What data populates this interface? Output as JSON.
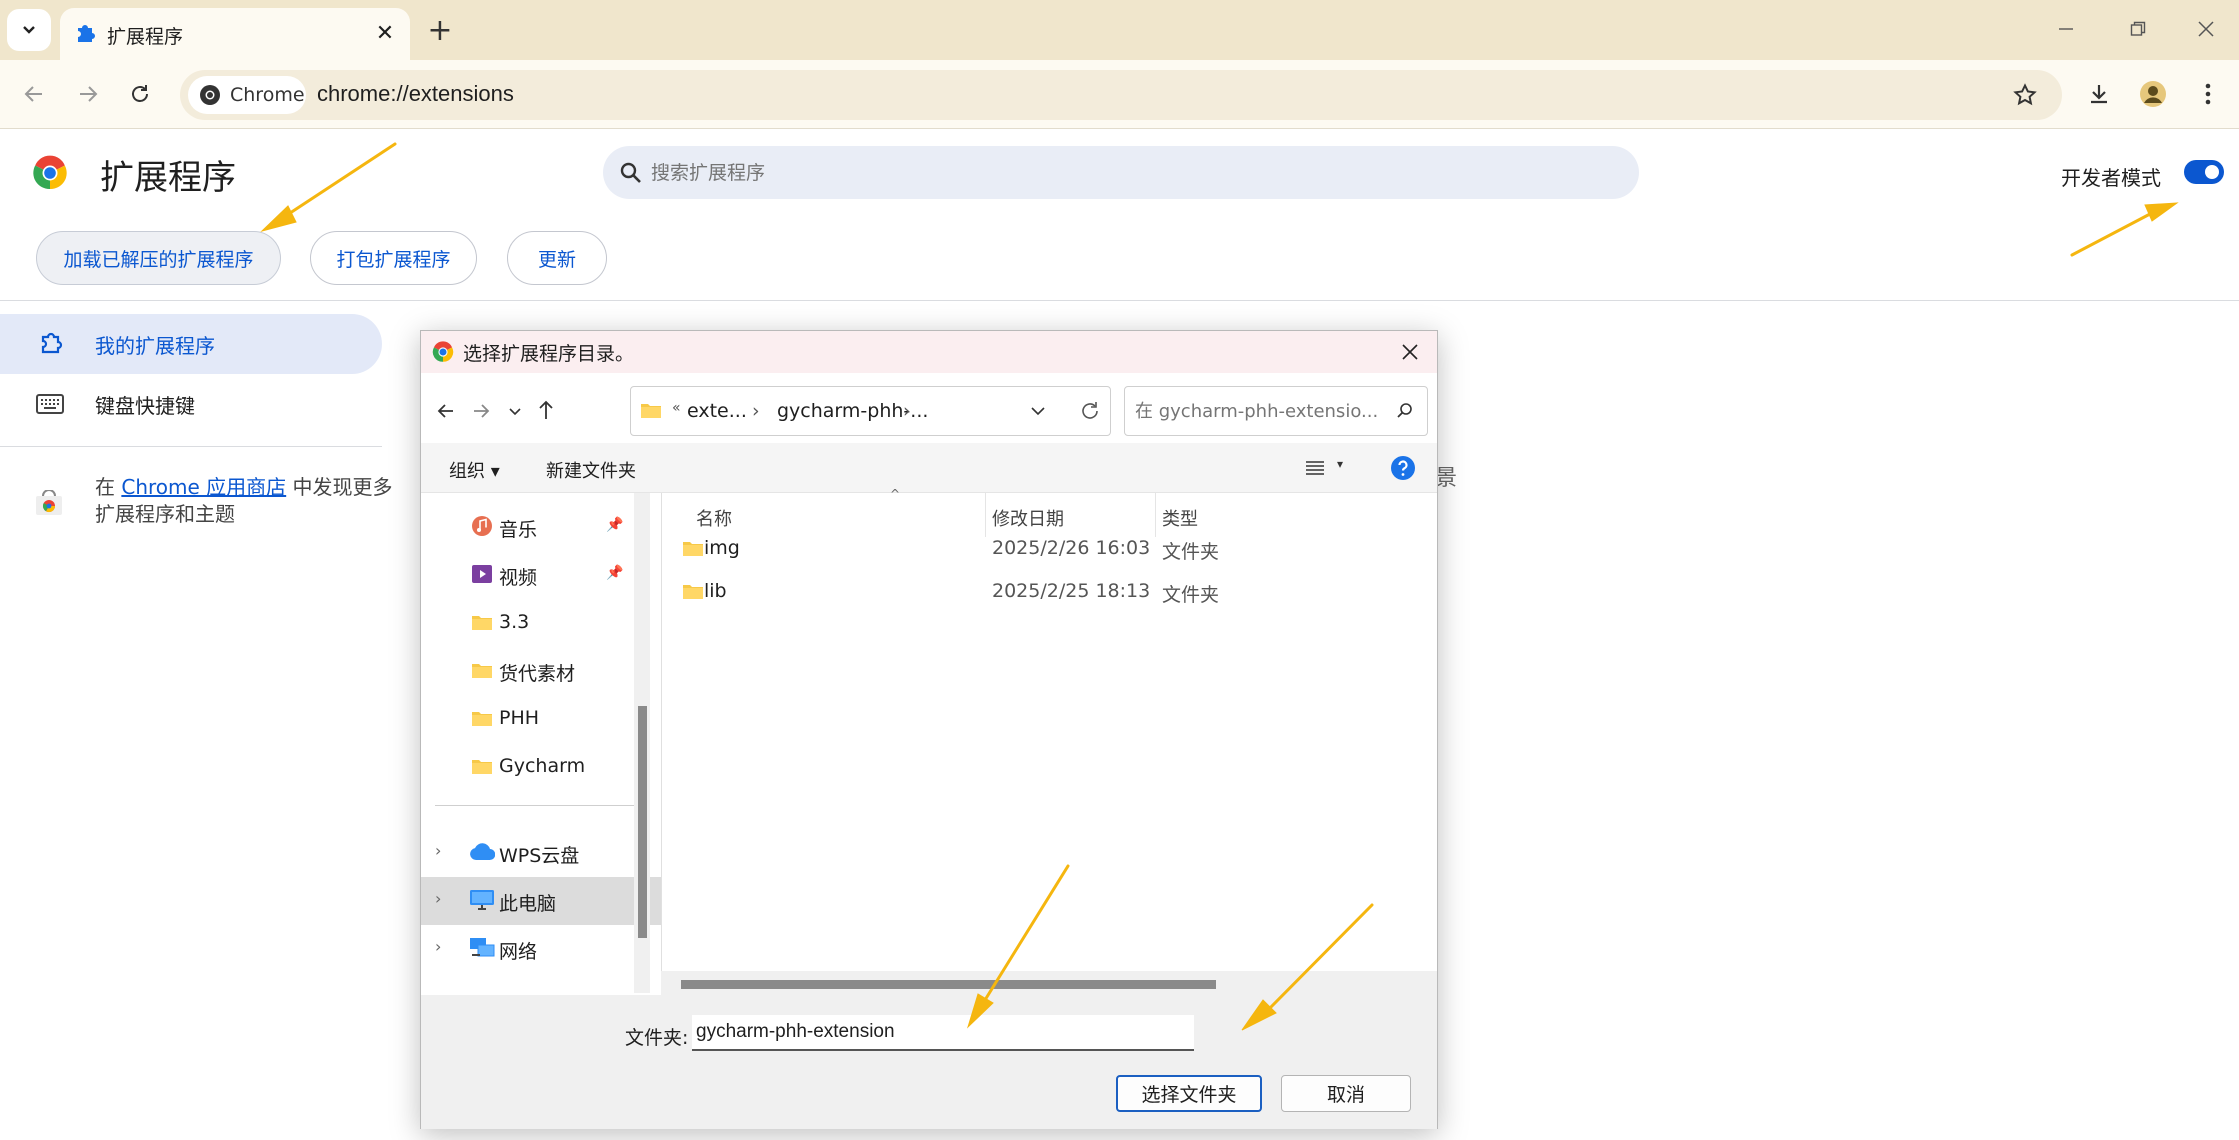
{
  "tab": {
    "title": "扩展程序"
  },
  "omnibox": {
    "chip_label": "Chrome",
    "url": "chrome://extensions"
  },
  "page": {
    "title": "扩展程序",
    "search_placeholder": "搜索扩展程序",
    "dev_mode_label": "开发者模式",
    "dev_mode_on": true,
    "buttons": {
      "load_unpacked": "加载已解压的扩展程序",
      "pack": "打包扩展程序",
      "update": "更新"
    },
    "bg_truncated_text": "景"
  },
  "sidebar": {
    "items": [
      {
        "label": "我的扩展程序"
      },
      {
        "label": "键盘快捷键"
      }
    ],
    "store_prefix": "在 ",
    "store_link": "Chrome 应用商店",
    "store_suffix": " 中发现更多扩展程序和主题"
  },
  "dialog": {
    "title": "选择扩展程序目录。",
    "breadcrumbs": [
      "«",
      "exte...",
      "›",
      "gycharm-phh-...",
      "›"
    ],
    "search_placeholder": "在 gycharm-phh-extensio...",
    "organize_label": "组织 ▾",
    "new_folder_label": "新建文件夹",
    "nav_items": [
      {
        "label": "音乐",
        "icon": "music-icon",
        "pinned": true
      },
      {
        "label": "视频",
        "icon": "video-icon",
        "pinned": true
      },
      {
        "label": "3.3",
        "icon": "folder-icon",
        "pinned": false
      },
      {
        "label": "货代素材",
        "icon": "folder-icon",
        "pinned": false
      },
      {
        "label": "PHH",
        "icon": "folder-icon",
        "pinned": false
      },
      {
        "label": "Gycharm",
        "icon": "folder-icon",
        "pinned": false
      }
    ],
    "nav_roots": [
      {
        "label": "WPS云盘",
        "icon": "cloud-icon"
      },
      {
        "label": "此电脑",
        "icon": "computer-icon",
        "selected": true
      },
      {
        "label": "网络",
        "icon": "network-icon"
      }
    ],
    "columns": {
      "name": "名称",
      "modified": "修改日期",
      "type": "类型"
    },
    "files": [
      {
        "name": "img",
        "modified": "2025/2/26 16:03",
        "type": "文件夹"
      },
      {
        "name": "lib",
        "modified": "2025/2/25 18:13",
        "type": "文件夹"
      }
    ],
    "folder_label": "文件夹:",
    "folder_value": "gycharm-phh-extension",
    "select_button": "选择文件夹",
    "cancel_button": "取消"
  },
  "colors": {
    "accent": "#0b57d0",
    "annotation": "#f5b60f",
    "tabstrip": "#f0e6cc"
  }
}
